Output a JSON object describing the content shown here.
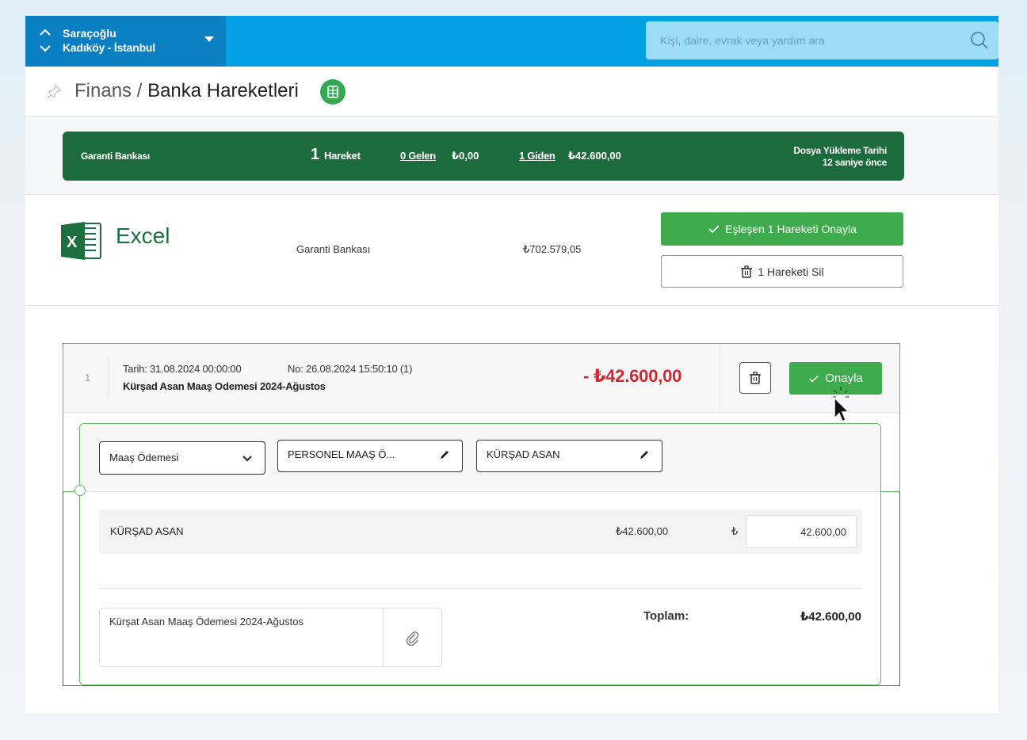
{
  "location": {
    "name": "Saraçoğlu",
    "city": "Kadıköy - İstanbul"
  },
  "search": {
    "placeholder": "Kişi, daire, evrak veya yardım ara"
  },
  "breadcrumb": {
    "section": "Finans",
    "separator": " / ",
    "current": "Banka Hareketleri"
  },
  "summary": {
    "bank": "Garanti Bankası",
    "count": "1",
    "count_label": "Hareket",
    "incoming_link": "0 Gelen",
    "incoming_amount": "₺0,00",
    "outgoing_link": "1 Giden",
    "outgoing_amount": "₺42.600,00",
    "upload_label": "Dosya Yükleme Tarihi",
    "upload_time": "12 saniye önce",
    "bar_color": "#1d6b3d"
  },
  "file": {
    "type_label": "Excel",
    "bank": "Garanti Bankası",
    "balance": "₺702.579,05",
    "approve_all_label": "Eşleşen 1 Hareketi Onayla",
    "delete_all_label": "1 Hareketi Sil"
  },
  "transaction": {
    "index": "1",
    "date": "Tarih: 31.08.2024 00:00:00",
    "number": "No: 26.08.2024 15:50:10 (1)",
    "description": "Kürşad Asan Maaş Odemesi 2024-Ağustos",
    "amount": "- ₺42.600,00",
    "amount_color": "#d32733",
    "approve_label": "Onayla",
    "category": "Maaş Ödemesi",
    "account": "PERSONEL MAAŞ Ö...",
    "person": "KÜRŞAD ASAN",
    "line": {
      "name": "KÜRŞAD ASAN",
      "amount": "₺42.600,00",
      "currency": "₺",
      "input_value": "42.600,00"
    },
    "note": "Kürşat Asan Maaş Ödemesi 2024-Ağustos",
    "total_label": "Toplam:",
    "total_value": "₺42.600,00"
  },
  "colors": {
    "topbar": "#01a0e4",
    "location": "#0a7fc2",
    "success": "#3eac4d",
    "error_border": "#d9252c"
  }
}
